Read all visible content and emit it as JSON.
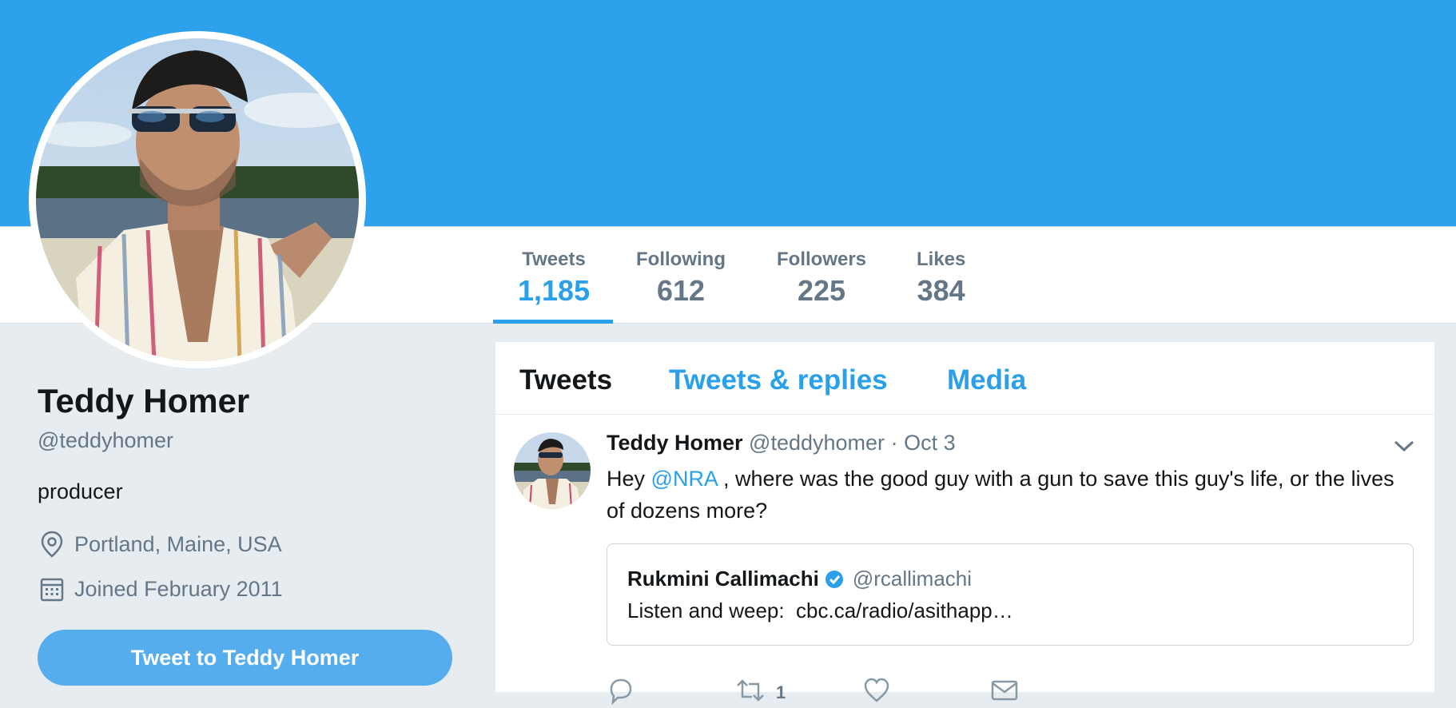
{
  "profile": {
    "name": "Teddy Homer",
    "handle": "@teddyhomer",
    "bio": "producer",
    "location": "Portland, Maine, USA",
    "joined": "Joined February 2011",
    "tweet_to_label": "Tweet to Teddy Homer"
  },
  "stats": [
    {
      "label": "Tweets",
      "value": "1,185",
      "active": true
    },
    {
      "label": "Following",
      "value": "612",
      "active": false
    },
    {
      "label": "Followers",
      "value": "225",
      "active": false
    },
    {
      "label": "Likes",
      "value": "384",
      "active": false
    }
  ],
  "tabs": [
    {
      "label": "Tweets",
      "active": true
    },
    {
      "label": "Tweets & replies",
      "active": false
    },
    {
      "label": "Media",
      "active": false
    }
  ],
  "tweet": {
    "author_name": "Teddy Homer",
    "author_handle": "@teddyhomer",
    "separator": "·",
    "date": "Oct 3",
    "text_before": "Hey ",
    "mention": "@NRA",
    "text_after": " , where was the good guy with a gun to save this guy's life, or the lives of dozens more?",
    "quote": {
      "name": "Rukmini Callimachi",
      "handle": "@rcallimachi",
      "text": "Listen and weep:  cbc.ca/radio/asithapp…"
    },
    "retweet_count": "1"
  },
  "colors": {
    "banner": "#2da1ec",
    "accent": "#2aa0ea",
    "button": "#55adee",
    "page_bg": "#e6ecf0",
    "muted": "#657786"
  },
  "icons": [
    "location-pin-icon",
    "calendar-icon",
    "chevron-down-icon",
    "verified-badge-icon",
    "reply-icon",
    "retweet-icon",
    "like-icon",
    "direct-message-icon"
  ]
}
